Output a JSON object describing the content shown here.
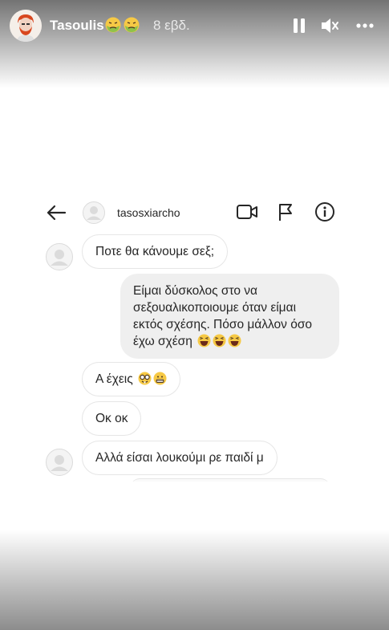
{
  "story": {
    "username": "Tasoulis",
    "time_ago": "8 εβδ.",
    "user_emojis": [
      "nauseated-face",
      "nauseated-face"
    ]
  },
  "chat": {
    "contact": "tasosxiarcho",
    "messages": [
      {
        "side": "incoming",
        "text": "Ποτε θα κάνουμε σεξ;",
        "avatar": true
      },
      {
        "side": "outgoing",
        "lines": [
          "Είμαι δύσκολος στο να",
          "σεξουαλικοποιουμε όταν είμαι",
          "εκτός σχέσης. Πόσο μάλλον όσο",
          "έχω σχέση"
        ],
        "emojis": [
          "laughing-face",
          "laughing-face",
          "laughing-face"
        ]
      },
      {
        "side": "incoming",
        "text": "Α έχεις",
        "emojis": [
          "nerd-face",
          "grimacing-face"
        ]
      },
      {
        "side": "incoming",
        "text": "Οκ οκ"
      },
      {
        "side": "incoming",
        "text": "Αλλά είσαι λουκούμι ρε παιδί μ",
        "avatar": true
      }
    ]
  },
  "colors": {
    "bubble_outgoing": "#efefef",
    "bubble_incoming_border": "#e6e6e6",
    "text": "#262626"
  }
}
